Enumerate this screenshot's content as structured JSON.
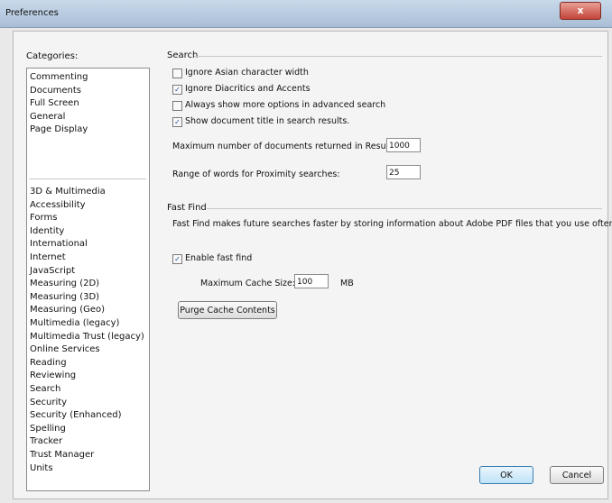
{
  "window": {
    "title": "Preferences",
    "close_glyph": "x"
  },
  "categories": {
    "label": "Categories:",
    "group1": [
      "Commenting",
      "Documents",
      "Full Screen",
      "General",
      "Page Display"
    ],
    "group2": [
      "3D & Multimedia",
      "Accessibility",
      "Forms",
      "Identity",
      "International",
      "Internet",
      "JavaScript",
      "Measuring (2D)",
      "Measuring (3D)",
      "Measuring (Geo)",
      "Multimedia (legacy)",
      "Multimedia Trust (legacy)",
      "Online Services",
      "Reading",
      "Reviewing",
      "Search",
      "Security",
      "Security (Enhanced)",
      "Spelling",
      "Tracker",
      "Trust Manager",
      "Units"
    ]
  },
  "search": {
    "title": "Search",
    "ignore_asian": {
      "label": "Ignore Asian character width",
      "checked": false
    },
    "ignore_diacritics": {
      "label": "Ignore Diacritics and Accents",
      "checked": true
    },
    "always_show": {
      "label": "Always show more options in advanced search",
      "checked": false
    },
    "show_title": {
      "label": "Show document title in search results.",
      "checked": true
    },
    "max_docs_label": "Maximum number of documents returned in Results:",
    "max_docs_value": "1000",
    "proximity_label": "Range of words for Proximity searches:",
    "proximity_value": "25"
  },
  "fast_find": {
    "title": "Fast Find",
    "description": "Fast Find makes future searches faster by storing information about Adobe PDF files that you use often.",
    "enable": {
      "label": "Enable fast find",
      "checked": true
    },
    "cache_label": "Maximum Cache Size:",
    "cache_value": "100",
    "cache_unit": "MB",
    "purge_label": "Purge Cache Contents"
  },
  "buttons": {
    "ok": "OK",
    "cancel": "Cancel"
  },
  "check_glyph": "✓"
}
